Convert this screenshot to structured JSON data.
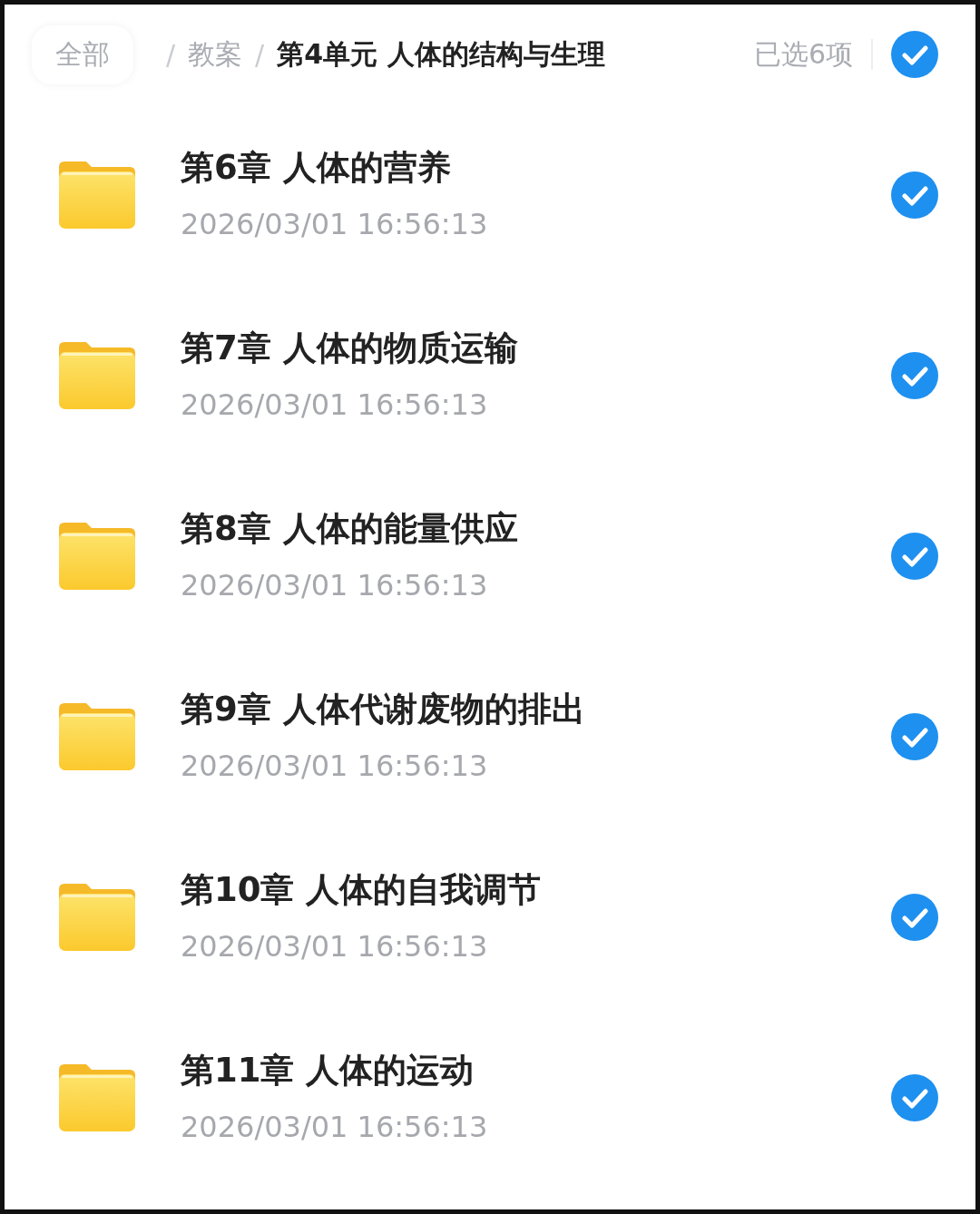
{
  "breadcrumb": {
    "root": "全部",
    "items": [
      {
        "separator": "/",
        "label": "教案",
        "current": false
      },
      {
        "separator": "/",
        "label": "第4单元 人体的结构与生理",
        "current": true
      }
    ]
  },
  "selection": {
    "count_label": "已选6项",
    "all_selected": true
  },
  "folders": [
    {
      "title": "第6章 人体的营养",
      "date": "2026/03/01 16:56:13",
      "selected": true
    },
    {
      "title": "第7章 人体的物质运输",
      "date": "2026/03/01 16:56:13",
      "selected": true
    },
    {
      "title": "第8章 人体的能量供应",
      "date": "2026/03/01 16:56:13",
      "selected": true
    },
    {
      "title": "第9章 人体代谢废物的排出",
      "date": "2026/03/01 16:56:13",
      "selected": true
    },
    {
      "title": "第10章 人体的自我调节",
      "date": "2026/03/01 16:56:13",
      "selected": true
    },
    {
      "title": "第11章 人体的运动",
      "date": "2026/03/01 16:56:13",
      "selected": true
    }
  ]
}
